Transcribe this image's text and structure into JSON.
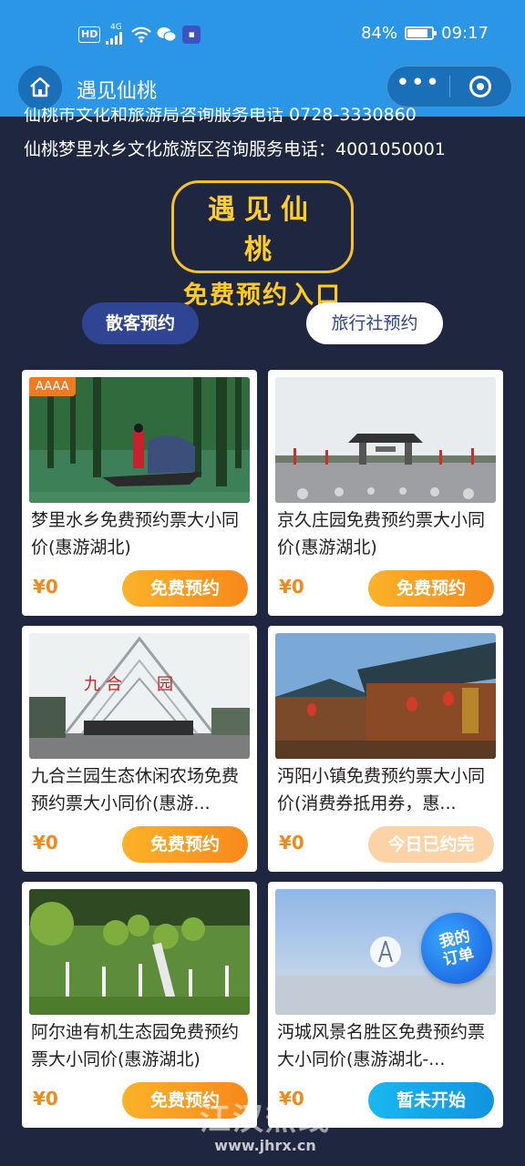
{
  "status": {
    "hd": "HD",
    "net": "4G",
    "battery_text": "84%",
    "battery_level": 0.84,
    "time": "09:17"
  },
  "nav": {
    "title": "遇见仙桃"
  },
  "info": {
    "line1": "仙桃市文化和旅游局咨询服务电话 0728-3330860",
    "line2": "仙桃梦里水乡文化旅游区咨询服务电话：4001050001"
  },
  "logo": {
    "top": "遇见仙桃",
    "bottom": "免费预约入口"
  },
  "tabs": [
    "散客预约",
    "旅行社预约"
  ],
  "cards": [
    {
      "title": "梦里水乡免费预约票大小同价(惠游湖北)",
      "price": "¥0",
      "button": "免费预约",
      "badge": "AAAA"
    },
    {
      "title": "京久庄园免费预约票大小同价(惠游湖北)",
      "price": "¥0",
      "button": "免费预约"
    },
    {
      "title": "九合兰园生态休闲农场免费预约票大小同价(惠游...",
      "price": "¥0",
      "button": "免费预约"
    },
    {
      "title": "沔阳小镇免费预约票大小同价(消费券抵用券，惠...",
      "price": "¥0",
      "button": "今日已约完"
    },
    {
      "title": "阿尔迪有机生态园免费预约票大小同价(惠游湖北)",
      "price": "¥0",
      "button": "免费预约"
    },
    {
      "title": "沔城风景名胜区免费预约票大小同价(惠游湖北-...",
      "price": "¥0",
      "button": "暂未开始"
    }
  ],
  "order_float": {
    "line1": "我的",
    "line2": "订单"
  },
  "watermark": {
    "line1": "江汉热线",
    "line2": "www.jhrx.cn"
  }
}
